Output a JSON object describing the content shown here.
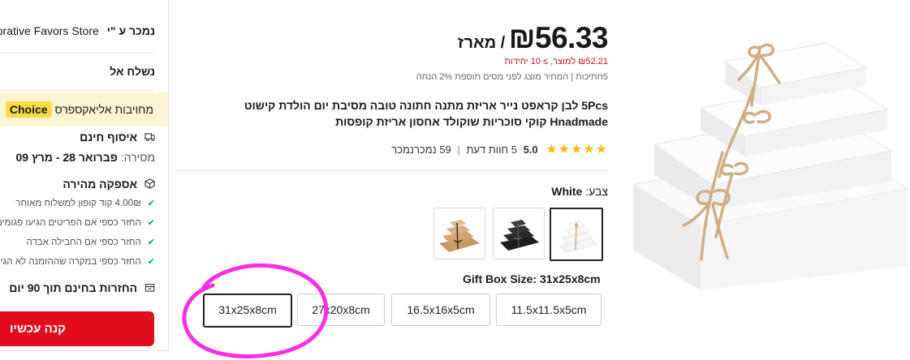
{
  "sidepanel": {
    "seller_label": "נמכר ע \"י",
    "store_name": "Decorative Favors Store",
    "ship_to_label": "נשלח אל",
    "choice_badge": "Choice",
    "choice_text": "מחויבות אליאקספרס",
    "pickup_label": "איסוף חינם",
    "delivery_prefix": "מסירה:",
    "delivery_dates": "פברואר 28 - מרץ 09",
    "fast_delivery_label": "אספקה מהירה",
    "bullets": [
      "4.00₪ קוד קופון למשלוח מאוחר",
      "החזר כספי אם הפריטים הגיעו פגומים",
      "החזר כספי אם החבילה אבדה",
      "החזר כספי במקרה שההזמנה לא הגיעה"
    ],
    "returns_label": "החזרות בחינם תוך 90 יום",
    "buy_now_label": "קנה עכשיו"
  },
  "product": {
    "price": "₪56.33",
    "price_unit": "/ מארז",
    "bulk_price": "₪52.21 למוצר, ≥ 10 יחידות",
    "tax_note": "5חתיכות | המחיר מוצג לפני מסים תוספת 2% הנחה",
    "title": "5Pcs לבן קראפט נייר אריזת מתנה חתונה טובה מסיבת יום הולדת קישוט Hnadmade קוקי סוכריות שוקולד אחסון אריזת קופסות",
    "rating_stars": "★★★★★",
    "rating_score": "5.0",
    "reviews": "5 חוות דעת",
    "rating_separator": "|",
    "sold": "59 נמכרנמכר"
  },
  "color": {
    "label": "צבע:",
    "selected": "White",
    "options": [
      "White",
      "Black",
      "Kraft"
    ]
  },
  "size": {
    "label": "Gift Box Size: 31x25x8cm",
    "options": [
      "31x25x8cm",
      "27x20x8cm",
      "16.5x16x5cm",
      "11.5x11.5x5cm"
    ],
    "selected_index": 0
  },
  "colors": {
    "accent_red": "#e10d1f",
    "choice_yellow": "#fadb45",
    "banner_bg": "#fdf5d2",
    "star": "#fcb819",
    "annotation": "#ff2ee6"
  }
}
